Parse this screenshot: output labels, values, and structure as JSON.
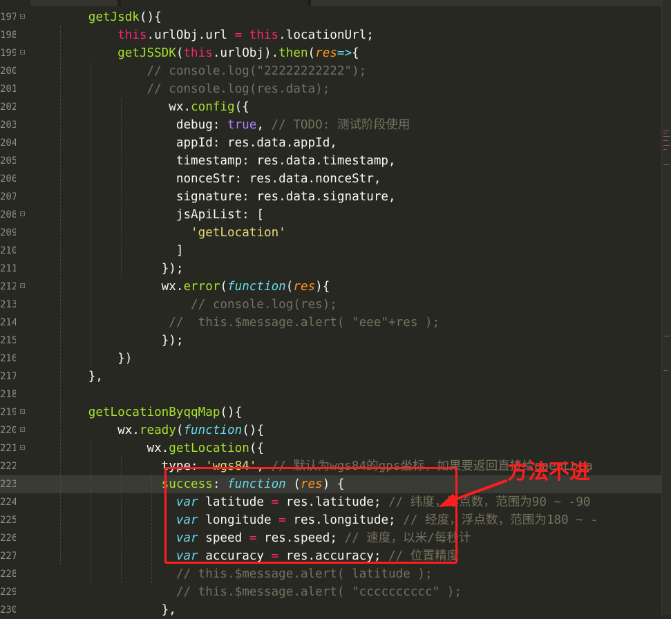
{
  "editor": {
    "lines": [
      {
        "num": "197",
        "fold": true,
        "tokens": [
          {
            "t": "        "
          },
          {
            "t": "getJsdk",
            "c": "f"
          },
          {
            "t": "(){"
          }
        ]
      },
      {
        "num": "198",
        "tokens": [
          {
            "t": "            "
          },
          {
            "t": "this",
            "c": "k"
          },
          {
            "t": ".urlObj.url "
          },
          {
            "t": "=",
            "c": "k"
          },
          {
            "t": " "
          },
          {
            "t": "this",
            "c": "k"
          },
          {
            "t": ".locationUrl;"
          }
        ]
      },
      {
        "num": "199",
        "fold": true,
        "tokens": [
          {
            "t": "            "
          },
          {
            "t": "getJSSDK",
            "c": "f"
          },
          {
            "t": "("
          },
          {
            "t": "this",
            "c": "k"
          },
          {
            "t": ".urlObj)."
          },
          {
            "t": "then",
            "c": "f"
          },
          {
            "t": "("
          },
          {
            "t": "res",
            "c": "p"
          },
          {
            "t": "=>",
            "c": "i"
          },
          {
            "t": "{"
          }
        ]
      },
      {
        "num": "200",
        "tokens": [
          {
            "t": "                "
          },
          {
            "t": "// console.log(\"22222222222\");",
            "c": "c"
          }
        ]
      },
      {
        "num": "201",
        "tokens": [
          {
            "t": "                "
          },
          {
            "t": "// console.log(res.data);",
            "c": "c"
          }
        ]
      },
      {
        "num": "202",
        "tokens": [
          {
            "t": "                   wx."
          },
          {
            "t": "config",
            "c": "f"
          },
          {
            "t": "({"
          }
        ]
      },
      {
        "num": "203",
        "tokens": [
          {
            "t": "                    debug: "
          },
          {
            "t": "true",
            "c": "n"
          },
          {
            "t": ", "
          },
          {
            "t": "// TODO: 测试阶段使用",
            "c": "c"
          }
        ]
      },
      {
        "num": "204",
        "tokens": [
          {
            "t": "                    appId: res.data.appId,"
          }
        ]
      },
      {
        "num": "205",
        "tokens": [
          {
            "t": "                    timestamp: res.data.timestamp,"
          }
        ]
      },
      {
        "num": "206",
        "tokens": [
          {
            "t": "                    nonceStr: res.data.nonceStr,"
          }
        ]
      },
      {
        "num": "207",
        "tokens": [
          {
            "t": "                    signature: res.data.signature,"
          }
        ]
      },
      {
        "num": "208",
        "fold": true,
        "tokens": [
          {
            "t": "                    jsApiList: ["
          }
        ]
      },
      {
        "num": "209",
        "tokens": [
          {
            "t": "                      "
          },
          {
            "t": "'getLocation'",
            "c": "s"
          }
        ]
      },
      {
        "num": "210",
        "tokens": [
          {
            "t": "                    ]"
          }
        ]
      },
      {
        "num": "211",
        "tokens": [
          {
            "t": "                  });"
          }
        ]
      },
      {
        "num": "212",
        "fold": true,
        "tokens": [
          {
            "t": "                  wx."
          },
          {
            "t": "error",
            "c": "f"
          },
          {
            "t": "("
          },
          {
            "t": "function",
            "c": "i"
          },
          {
            "t": "("
          },
          {
            "t": "res",
            "c": "p"
          },
          {
            "t": "){"
          }
        ]
      },
      {
        "num": "213",
        "tokens": [
          {
            "t": "                      "
          },
          {
            "t": "// console.log(res);",
            "c": "c"
          }
        ]
      },
      {
        "num": "214",
        "tokens": [
          {
            "t": "                   "
          },
          {
            "t": "//  this.$message.alert( \"eee\"+res );",
            "c": "c"
          }
        ]
      },
      {
        "num": "215",
        "tokens": [
          {
            "t": "                  });"
          }
        ]
      },
      {
        "num": "216",
        "tokens": [
          {
            "t": "            })"
          }
        ]
      },
      {
        "num": "217",
        "tokens": [
          {
            "t": "        },"
          }
        ]
      },
      {
        "num": "218",
        "tokens": []
      },
      {
        "num": "219",
        "fold": true,
        "tokens": [
          {
            "t": "        "
          },
          {
            "t": "getLocationByqqMap",
            "c": "f"
          },
          {
            "t": "(){"
          }
        ]
      },
      {
        "num": "220",
        "fold": true,
        "tokens": [
          {
            "t": "            wx."
          },
          {
            "t": "ready",
            "c": "f"
          },
          {
            "t": "("
          },
          {
            "t": "function",
            "c": "i"
          },
          {
            "t": "(){"
          }
        ]
      },
      {
        "num": "221",
        "fold": true,
        "tokens": [
          {
            "t": "                wx."
          },
          {
            "t": "getLocation",
            "c": "f"
          },
          {
            "t": "({"
          }
        ]
      },
      {
        "num": "222",
        "tokens": [
          {
            "t": "                  type: "
          },
          {
            "t": "'wgs84'",
            "c": "s"
          },
          {
            "t": ", "
          },
          {
            "t": "// 默认为wgs84的gps坐标，如果要返回直接给openLoca",
            "c": "c"
          }
        ]
      },
      {
        "num": "223",
        "current": true,
        "tokens": [
          {
            "t": "                  "
          },
          {
            "t": "success",
            "c": "f"
          },
          {
            "t": ": "
          },
          {
            "t": "function",
            "c": "i"
          },
          {
            "t": " ("
          },
          {
            "t": "res",
            "c": "p"
          },
          {
            "t": ") {"
          }
        ]
      },
      {
        "num": "224",
        "tokens": [
          {
            "t": "                    "
          },
          {
            "t": "var",
            "c": "i"
          },
          {
            "t": " latitude "
          },
          {
            "t": "=",
            "c": "k"
          },
          {
            "t": " res.latitude; "
          },
          {
            "t": "// 纬度，浮点数，范围为90 ~ -90",
            "c": "c"
          }
        ]
      },
      {
        "num": "225",
        "tokens": [
          {
            "t": "                    "
          },
          {
            "t": "var",
            "c": "i"
          },
          {
            "t": " longitude "
          },
          {
            "t": "=",
            "c": "k"
          },
          {
            "t": " res.longitude; "
          },
          {
            "t": "// 经度，浮点数，范围为180 ~ -",
            "c": "c"
          }
        ]
      },
      {
        "num": "226",
        "tokens": [
          {
            "t": "                    "
          },
          {
            "t": "var",
            "c": "i"
          },
          {
            "t": " speed "
          },
          {
            "t": "=",
            "c": "k"
          },
          {
            "t": " res.speed; "
          },
          {
            "t": "// 速度，以米/每秒计",
            "c": "c"
          }
        ]
      },
      {
        "num": "227",
        "tokens": [
          {
            "t": "                    "
          },
          {
            "t": "var",
            "c": "i"
          },
          {
            "t": " accuracy "
          },
          {
            "t": "=",
            "c": "k"
          },
          {
            "t": " res.accuracy; "
          },
          {
            "t": "// 位置精度",
            "c": "c"
          }
        ]
      },
      {
        "num": "228",
        "tokens": [
          {
            "t": "                    "
          },
          {
            "t": "// this.$message.alert( latitude );",
            "c": "c"
          }
        ]
      },
      {
        "num": "229",
        "tokens": [
          {
            "t": "                    "
          },
          {
            "t": "// this.$message.alert( \"cccccccccc\" );",
            "c": "c"
          }
        ]
      },
      {
        "num": "230",
        "tokens": [
          {
            "t": "                  },"
          }
        ]
      }
    ]
  },
  "annotation": {
    "text": "方法不进",
    "color": "#ff1e1e"
  },
  "colors": {
    "background": "#272822",
    "keyword": "#f92672",
    "function": "#a6e22e",
    "string": "#e6db74",
    "comment": "#75715e"
  }
}
